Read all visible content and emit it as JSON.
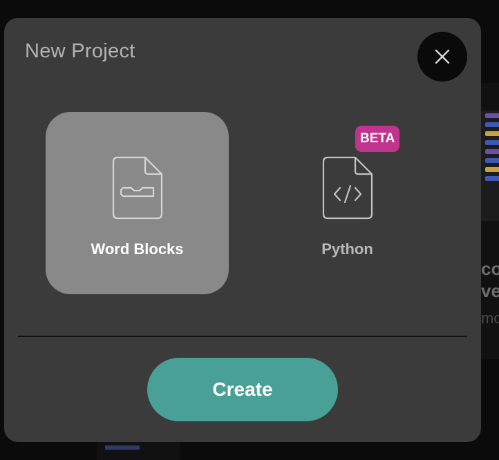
{
  "dialog": {
    "title": "New Project",
    "close_icon": "close-icon"
  },
  "options": [
    {
      "label": "Word Blocks",
      "icon": "block-file-icon",
      "selected": true
    },
    {
      "label": "Python",
      "icon": "code-file-icon",
      "badge": "BETA",
      "selected": false
    }
  ],
  "actions": {
    "create_label": "Create"
  },
  "colors": {
    "dialog_bg": "#3b3b3b",
    "selected_option_bg": "#898989",
    "create_button": "#48a096",
    "beta_badge": "#c0348f",
    "close_button_bg": "#0a0a0a"
  }
}
